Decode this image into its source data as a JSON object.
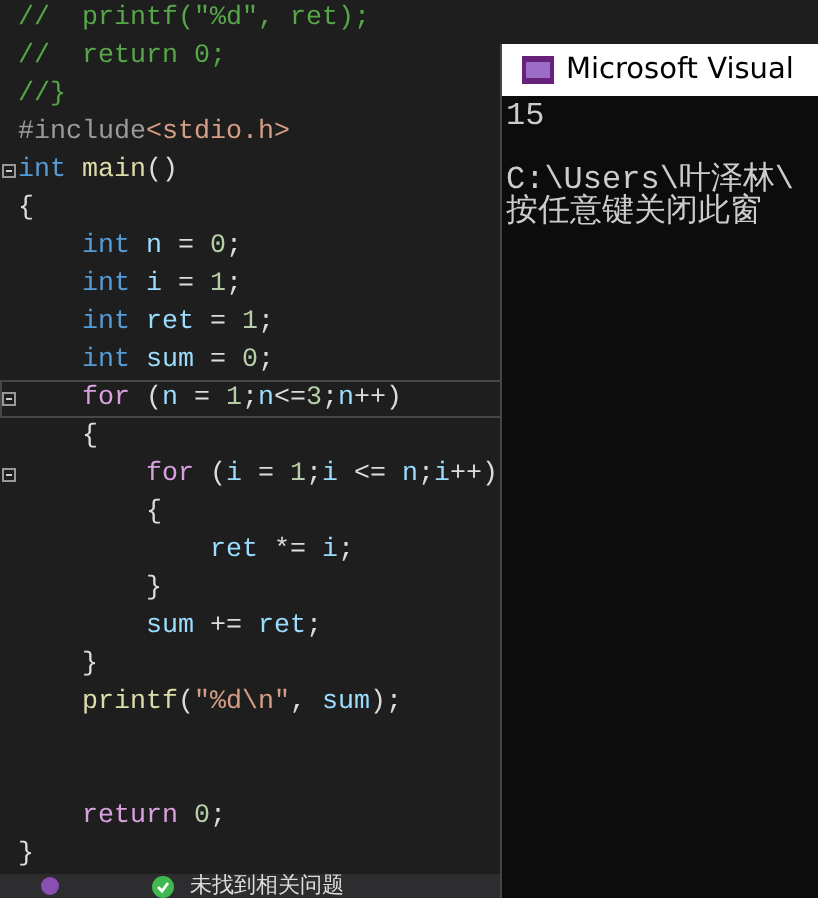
{
  "editor": {
    "lines": [
      {
        "current": false,
        "fold": false,
        "tokens": [
          {
            "text": "//  printf(\"%d\", ret);",
            "kind": "comment"
          }
        ]
      },
      {
        "current": false,
        "fold": false,
        "tokens": [
          {
            "text": "//  return 0;",
            "kind": "comment"
          }
        ]
      },
      {
        "current": false,
        "fold": false,
        "tokens": [
          {
            "text": "//}",
            "kind": "comment"
          }
        ]
      },
      {
        "current": false,
        "fold": false,
        "tokens": [
          {
            "text": "#include",
            "kind": "preproc"
          },
          {
            "text": "<stdio.h>",
            "kind": "string"
          }
        ]
      },
      {
        "current": false,
        "fold": true,
        "tokens": [
          {
            "text": "int",
            "kind": "keyword"
          },
          {
            "text": " main",
            "kind": "func"
          },
          {
            "text": "()",
            "kind": "plain"
          }
        ]
      },
      {
        "current": false,
        "fold": false,
        "tokens": [
          {
            "text": "{",
            "kind": "plain"
          }
        ]
      },
      {
        "current": false,
        "fold": false,
        "tokens": [
          {
            "text": "    int",
            "kind": "keyword"
          },
          {
            "text": " n",
            "kind": "ident"
          },
          {
            "text": " = ",
            "kind": "plain"
          },
          {
            "text": "0",
            "kind": "number"
          },
          {
            "text": ";",
            "kind": "plain"
          }
        ]
      },
      {
        "current": false,
        "fold": false,
        "tokens": [
          {
            "text": "    int",
            "kind": "keyword"
          },
          {
            "text": " i",
            "kind": "ident"
          },
          {
            "text": " = ",
            "kind": "plain"
          },
          {
            "text": "1",
            "kind": "number"
          },
          {
            "text": ";",
            "kind": "plain"
          }
        ]
      },
      {
        "current": false,
        "fold": false,
        "tokens": [
          {
            "text": "    int",
            "kind": "keyword"
          },
          {
            "text": " ret",
            "kind": "ident"
          },
          {
            "text": " = ",
            "kind": "plain"
          },
          {
            "text": "1",
            "kind": "number"
          },
          {
            "text": ";",
            "kind": "plain"
          }
        ]
      },
      {
        "current": false,
        "fold": false,
        "tokens": [
          {
            "text": "    int",
            "kind": "keyword"
          },
          {
            "text": " sum",
            "kind": "ident"
          },
          {
            "text": " = ",
            "kind": "plain"
          },
          {
            "text": "0",
            "kind": "number"
          },
          {
            "text": ";",
            "kind": "plain"
          }
        ]
      },
      {
        "current": true,
        "fold": true,
        "tokens": [
          {
            "text": "    for",
            "kind": "control"
          },
          {
            "text": " (",
            "kind": "plain"
          },
          {
            "text": "n",
            "kind": "ident"
          },
          {
            "text": " = ",
            "kind": "plain"
          },
          {
            "text": "1",
            "kind": "number"
          },
          {
            "text": ";",
            "kind": "plain"
          },
          {
            "text": "n",
            "kind": "ident"
          },
          {
            "text": "<=",
            "kind": "plain"
          },
          {
            "text": "3",
            "kind": "number"
          },
          {
            "text": ";",
            "kind": "plain"
          },
          {
            "text": "n",
            "kind": "ident"
          },
          {
            "text": "++)",
            "kind": "plain"
          }
        ]
      },
      {
        "current": false,
        "fold": false,
        "tokens": [
          {
            "text": "    {",
            "kind": "plain"
          }
        ]
      },
      {
        "current": false,
        "fold": true,
        "tokens": [
          {
            "text": "        for",
            "kind": "control"
          },
          {
            "text": " (",
            "kind": "plain"
          },
          {
            "text": "i",
            "kind": "ident"
          },
          {
            "text": " = ",
            "kind": "plain"
          },
          {
            "text": "1",
            "kind": "number"
          },
          {
            "text": ";",
            "kind": "plain"
          },
          {
            "text": "i",
            "kind": "ident"
          },
          {
            "text": " <= ",
            "kind": "plain"
          },
          {
            "text": "n",
            "kind": "ident"
          },
          {
            "text": ";",
            "kind": "plain"
          },
          {
            "text": "i",
            "kind": "ident"
          },
          {
            "text": "++)",
            "kind": "plain"
          }
        ]
      },
      {
        "current": false,
        "fold": false,
        "tokens": [
          {
            "text": "        {",
            "kind": "plain"
          }
        ]
      },
      {
        "current": false,
        "fold": false,
        "tokens": [
          {
            "text": "            ret",
            "kind": "ident"
          },
          {
            "text": " *= ",
            "kind": "plain"
          },
          {
            "text": "i",
            "kind": "ident"
          },
          {
            "text": ";",
            "kind": "plain"
          }
        ]
      },
      {
        "current": false,
        "fold": false,
        "tokens": [
          {
            "text": "        }",
            "kind": "plain"
          }
        ]
      },
      {
        "current": false,
        "fold": false,
        "tokens": [
          {
            "text": "        sum",
            "kind": "ident"
          },
          {
            "text": " += ",
            "kind": "plain"
          },
          {
            "text": "ret",
            "kind": "ident"
          },
          {
            "text": ";",
            "kind": "plain"
          }
        ]
      },
      {
        "current": false,
        "fold": false,
        "tokens": [
          {
            "text": "    }",
            "kind": "plain"
          }
        ]
      },
      {
        "current": false,
        "fold": false,
        "tokens": [
          {
            "text": "    printf",
            "kind": "func"
          },
          {
            "text": "(",
            "kind": "plain"
          },
          {
            "text": "\"%d\\n\"",
            "kind": "string"
          },
          {
            "text": ", ",
            "kind": "plain"
          },
          {
            "text": "sum",
            "kind": "ident"
          },
          {
            "text": ");",
            "kind": "plain"
          }
        ]
      },
      {
        "current": false,
        "fold": false
      },
      {
        "current": false,
        "fold": false
      },
      {
        "current": false,
        "fold": false,
        "tokens": [
          {
            "text": "    return",
            "kind": "control"
          },
          {
            "text": " 0",
            "kind": "number"
          },
          {
            "text": ";",
            "kind": "plain"
          }
        ]
      },
      {
        "current": false,
        "fold": false,
        "tokens": [
          {
            "text": "}",
            "kind": "plain"
          }
        ]
      }
    ]
  },
  "status_bar": {
    "message": "未找到相关问题"
  },
  "console": {
    "title": "Microsoft Visual",
    "blocks": [
      {
        "lines": [
          "15"
        ]
      },
      {
        "lines": [
          "C:\\Users\\叶泽林\\",
          "按任意键关闭此窗"
        ]
      }
    ]
  }
}
